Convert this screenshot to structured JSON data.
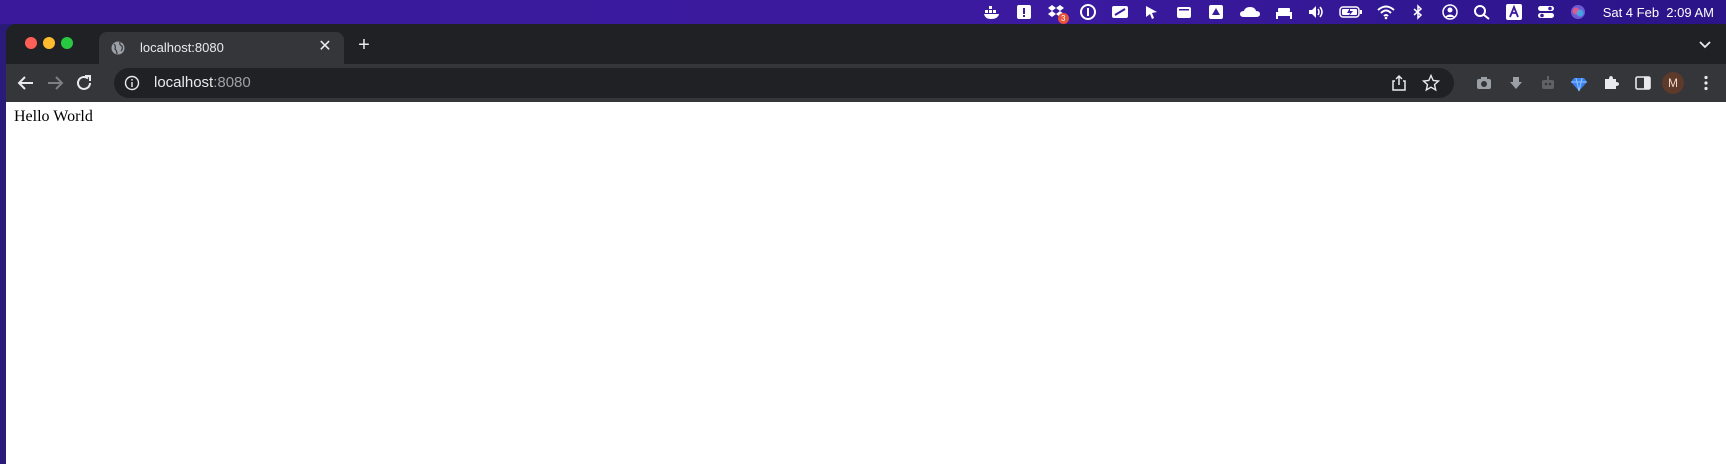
{
  "menubar": {
    "icons": [
      "docker-icon",
      "alert-icon",
      "dropbox-icon",
      "password-icon",
      "screen-icon",
      "cursor-icon",
      "window-icon",
      "drive-icon",
      "cloud-icon",
      "bed-icon",
      "volume-icon",
      "battery-icon",
      "wifi-icon",
      "bluetooth-icon",
      "user-icon",
      "search-icon",
      "text-input-icon",
      "control-center-icon",
      "siri-icon"
    ],
    "badge_count": "3",
    "date": "Sat 4 Feb",
    "time": "2:09 AM"
  },
  "browser": {
    "tab": {
      "title": "localhost:8080",
      "favicon": "globe-icon"
    },
    "address": {
      "host": "localhost",
      "port": ":8080"
    },
    "profile_initial": "M"
  },
  "page": {
    "text": "Hello World"
  },
  "colors": {
    "menubar": "#3b1aa0",
    "tabstrip": "#202124",
    "toolbar": "#35363a",
    "close": "#ff5f57",
    "minimize": "#febc2e",
    "zoom": "#28c840"
  }
}
